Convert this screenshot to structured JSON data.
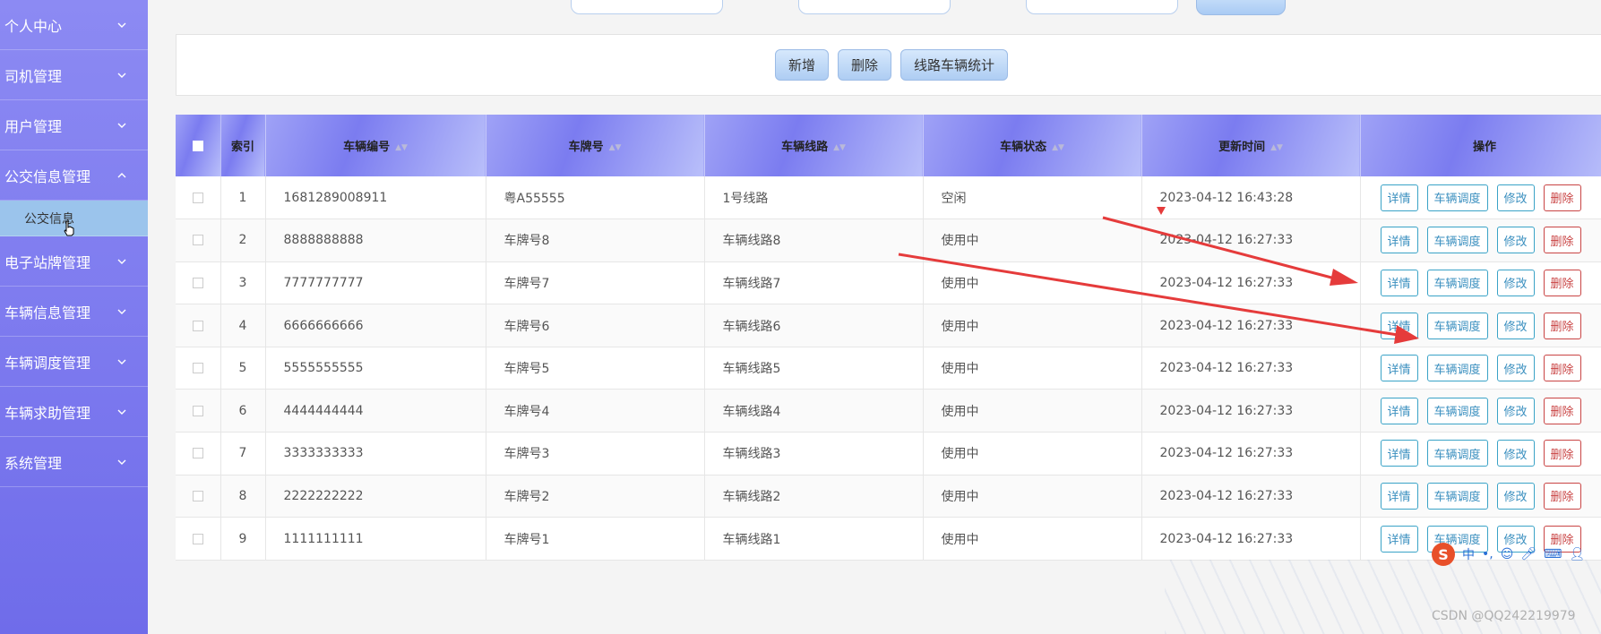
{
  "sidebar": {
    "items": [
      {
        "label": "个人中心"
      },
      {
        "label": "司机管理"
      },
      {
        "label": "用户管理"
      },
      {
        "label": "公交信息管理",
        "expanded": true
      },
      {
        "label": "电子站牌管理"
      },
      {
        "label": "车辆信息管理"
      },
      {
        "label": "车辆调度管理"
      },
      {
        "label": "车辆求助管理"
      },
      {
        "label": "系统管理"
      }
    ],
    "active_subitem": "公交信息"
  },
  "actions": {
    "add": "新增",
    "delete": "删除",
    "stats": "线路车辆统计"
  },
  "table": {
    "headers": {
      "index": "索引",
      "vehicle_no": "车辆编号",
      "plate": "车牌号",
      "route": "车辆线路",
      "status": "车辆状态",
      "updated": "更新时间",
      "ops": "操作"
    },
    "op_labels": {
      "detail": "详情",
      "dispatch": "车辆调度",
      "edit": "修改",
      "delete": "删除"
    },
    "rows": [
      {
        "index": "1",
        "vehicle_no": "1681289008911",
        "plate": "粤A55555",
        "route": "1号线路",
        "status": "空闲",
        "updated": "2023-04-12 16:43:28"
      },
      {
        "index": "2",
        "vehicle_no": "8888888888",
        "plate": "车牌号8",
        "route": "车辆线路8",
        "status": "使用中",
        "updated": "2023-04-12 16:27:33"
      },
      {
        "index": "3",
        "vehicle_no": "7777777777",
        "plate": "车牌号7",
        "route": "车辆线路7",
        "status": "使用中",
        "updated": "2023-04-12 16:27:33"
      },
      {
        "index": "4",
        "vehicle_no": "6666666666",
        "plate": "车牌号6",
        "route": "车辆线路6",
        "status": "使用中",
        "updated": "2023-04-12 16:27:33"
      },
      {
        "index": "5",
        "vehicle_no": "5555555555",
        "plate": "车牌号5",
        "route": "车辆线路5",
        "status": "使用中",
        "updated": "2023-04-12 16:27:33"
      },
      {
        "index": "6",
        "vehicle_no": "4444444444",
        "plate": "车牌号4",
        "route": "车辆线路4",
        "status": "使用中",
        "updated": "2023-04-12 16:27:33"
      },
      {
        "index": "7",
        "vehicle_no": "3333333333",
        "plate": "车牌号3",
        "route": "车辆线路3",
        "status": "使用中",
        "updated": "2023-04-12 16:27:33"
      },
      {
        "index": "8",
        "vehicle_no": "2222222222",
        "plate": "车牌号2",
        "route": "车辆线路2",
        "status": "使用中",
        "updated": "2023-04-12 16:27:33"
      },
      {
        "index": "9",
        "vehicle_no": "1111111111",
        "plate": "车牌号1",
        "route": "车辆线路1",
        "status": "使用中",
        "updated": "2023-04-12 16:27:33"
      }
    ]
  },
  "ime": {
    "lang": "中"
  },
  "watermark": "CSDN @QQ242219979",
  "colors": {
    "sidebar": "#7b78ee",
    "annotation_arrow": "#e53b3b"
  }
}
